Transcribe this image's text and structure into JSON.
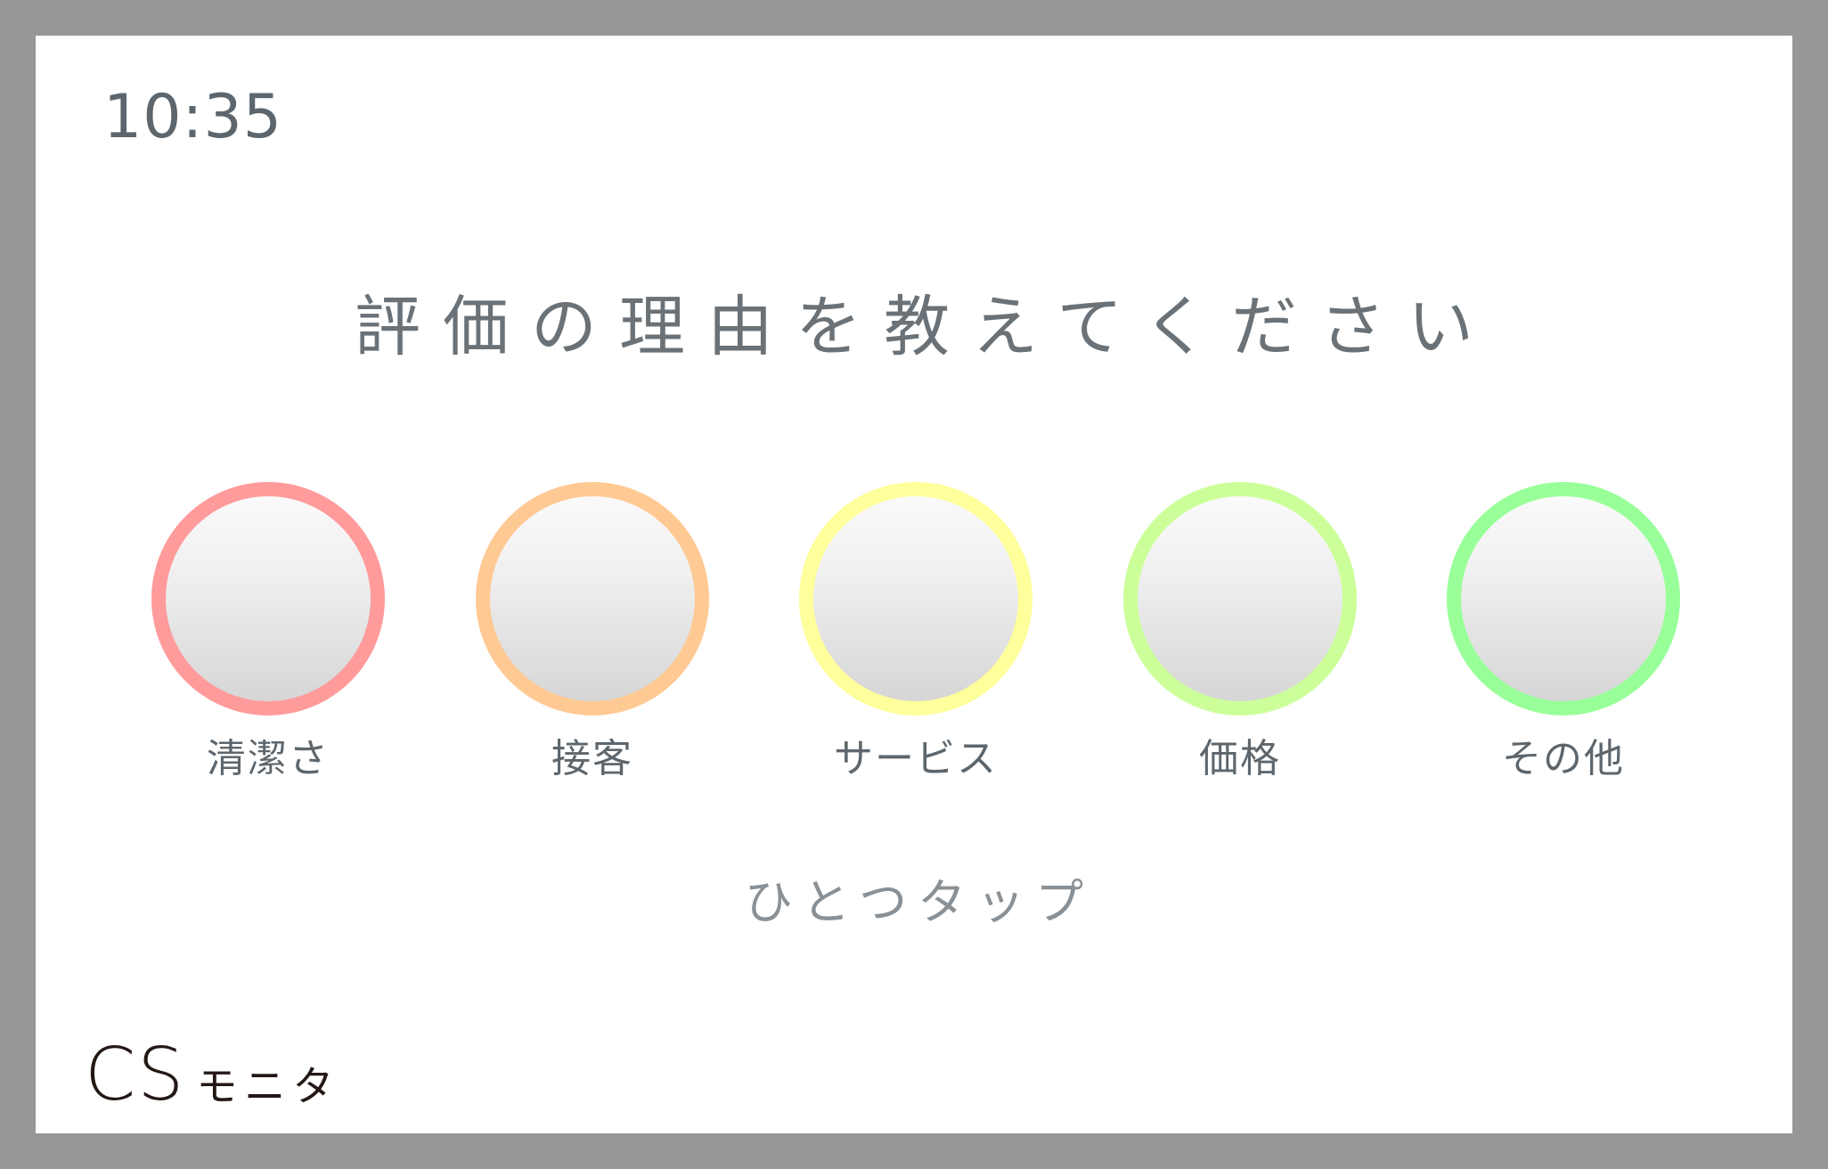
{
  "status": {
    "time": "10:35"
  },
  "prompt": "評価の理由を教えてください",
  "choices": [
    {
      "label": "清潔さ",
      "color": "#ff9b9b"
    },
    {
      "label": "接客",
      "color": "#ffc994"
    },
    {
      "label": "サービス",
      "color": "#ffff9b"
    },
    {
      "label": "価格",
      "color": "#ccff99"
    },
    {
      "label": "その他",
      "color": "#99ff99"
    }
  ],
  "hint": "ひとつタップ",
  "logo": {
    "latin": "CS",
    "kana": "モニタ"
  },
  "colors": {
    "frame": "#979797",
    "background": "#ffffff",
    "text": "#5d666c"
  }
}
